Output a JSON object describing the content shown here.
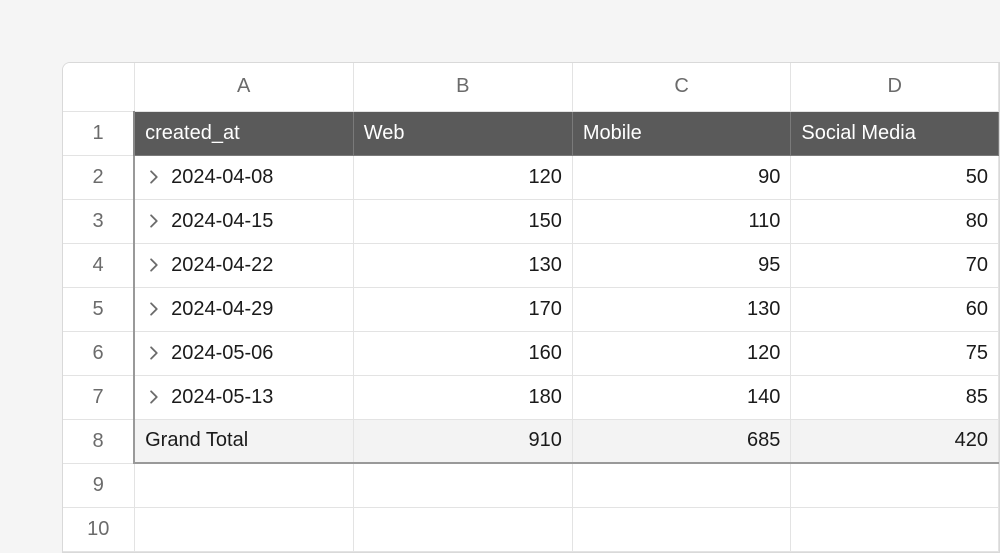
{
  "columns": [
    "A",
    "B",
    "C",
    "D"
  ],
  "rowNumbers": [
    "1",
    "2",
    "3",
    "4",
    "5",
    "6",
    "7",
    "8",
    "9",
    "10"
  ],
  "pivot": {
    "headers": [
      "created_at",
      "Web",
      "Mobile",
      "Social Media"
    ],
    "rows": [
      {
        "label": "2024-04-08",
        "values": [
          "120",
          "90",
          "50"
        ]
      },
      {
        "label": "2024-04-15",
        "values": [
          "150",
          "110",
          "80"
        ]
      },
      {
        "label": "2024-04-22",
        "values": [
          "130",
          "95",
          "70"
        ]
      },
      {
        "label": "2024-04-29",
        "values": [
          "170",
          "130",
          "60"
        ]
      },
      {
        "label": "2024-05-06",
        "values": [
          "160",
          "120",
          "75"
        ]
      },
      {
        "label": "2024-05-13",
        "values": [
          "180",
          "140",
          "85"
        ]
      }
    ],
    "totalLabel": "Grand Total",
    "totals": [
      "910",
      "685",
      "420"
    ]
  }
}
